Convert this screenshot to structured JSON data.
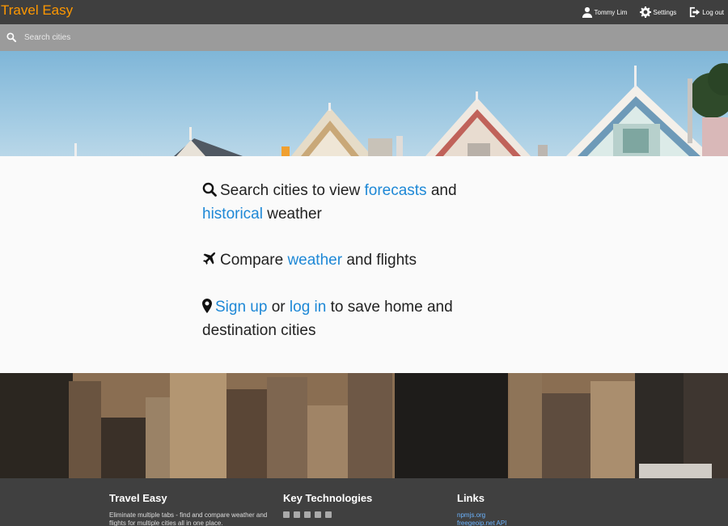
{
  "topbar": {
    "brand": "Travel Easy",
    "user_name": "Tommy Lim",
    "settings_label": "Settings",
    "logout_label": "Log out"
  },
  "search": {
    "placeholder": "Search cities"
  },
  "features": {
    "search": {
      "prefix": "Search cities to view",
      "link1": "forecasts",
      "middle": "and",
      "link2": "historical",
      "suffix": "weather"
    },
    "compare": {
      "prefix": "Compare",
      "link": "weather",
      "suffix": "and flights"
    },
    "account": {
      "link1": "Sign up",
      "middle": "or",
      "link2": "log in",
      "suffix": "to save home and destination cities"
    }
  },
  "footer": {
    "about_title": "Travel Easy",
    "about_text": "Eliminate multiple tabs - find and compare weather and flights for multiple cities all in one place.",
    "tech_title": "Key Technologies",
    "tech_icons": [
      "react-icon",
      "redux-icon",
      "node-icon",
      "html5-icon",
      "css3-icon"
    ],
    "links_title": "Links",
    "links": [
      "npmjs.org",
      "freegeoip.net API"
    ]
  },
  "colors": {
    "brand": "#ff9800",
    "link": "#1e88d6",
    "topbar": "#3f3f3f",
    "searchbar": "#9b9b9b",
    "footer": "#404040"
  }
}
